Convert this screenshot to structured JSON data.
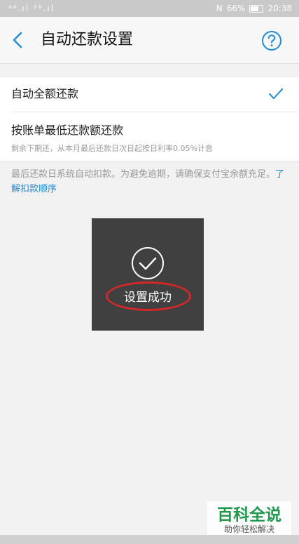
{
  "status_bar": {
    "signal_text": "⁴⁶.ıl ²⁶.ıl",
    "nfc_label": "N",
    "battery_text": "66%",
    "battery_level": 0.66,
    "time": "20:38"
  },
  "nav": {
    "title": "自动还款设置",
    "back_icon": "chevron-left-icon",
    "help_icon": "question-circle-icon"
  },
  "options": {
    "auto_full": {
      "label": "自动全额还款",
      "selected": true
    },
    "min_repay": {
      "label": "按账单最低还款额还款",
      "note": "剩余下期还，从本月最后还款日次日起按日利率0.05%计息"
    }
  },
  "footnote": {
    "text": "最后还款日系统自动扣款。为避免逾期，请确保支付宝余额充足。",
    "link": "了解扣款顺序"
  },
  "toast": {
    "text": "设置成功"
  },
  "watermark": {
    "title": "百科全说",
    "subtitle": "助你轻松解决"
  },
  "colors": {
    "accent_blue": "#1b8be0",
    "highlight_red": "#d42828",
    "toast_bg": "#404040"
  }
}
